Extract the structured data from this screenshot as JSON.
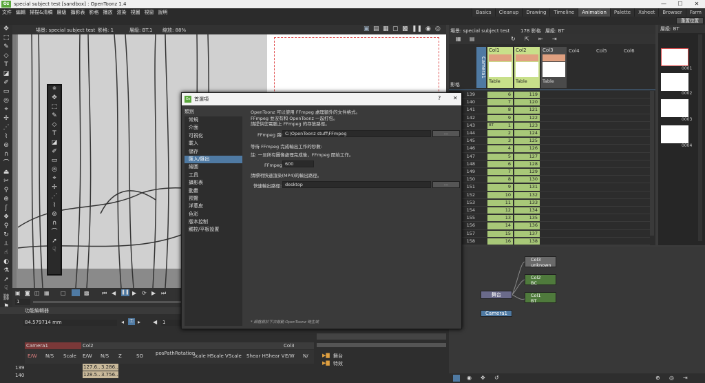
{
  "window": {
    "title": "special subject test [sandbox] : OpenToonz 1.4",
    "logo": "Oz",
    "controls": [
      "—",
      "☐",
      "✕"
    ]
  },
  "menu": [
    "文件",
    "編輯",
    "掃描&清稿",
    "層級",
    "攝影表",
    "影格",
    "播放",
    "渲染",
    "視圖",
    "視窗",
    "說明"
  ],
  "rooms": [
    "Basics",
    "Cleanup",
    "Drawing",
    "Timeline",
    "Animation",
    "Palette",
    "Xsheet",
    "Browser",
    "Farm"
  ],
  "active_room": "Animation",
  "reset_button": "重置位置",
  "viewer": {
    "scene": "場景: special subject test",
    "frame": "影格: 1",
    "level": "層級: BT.1",
    "zoom": "縮放: 88%",
    "frame_field": "1"
  },
  "func_editor": {
    "title": "功能編輯器",
    "value": "84.579714 mm",
    "frame": "1",
    "groups": [
      "Camera1",
      "Col2",
      "Col3"
    ],
    "columns": [
      "E/W",
      "N/S",
      "Scale",
      "E/W",
      "N/S",
      "Z",
      "SO",
      "posPath",
      "Rotation",
      "Scale H",
      "Scale V",
      "Scale",
      "Shear H",
      "Shear V",
      "E/W",
      "N/"
    ],
    "rows": [
      {
        "frame": "139",
        "values": [
          "",
          "",
          "",
          "127.6...",
          "3.286..."
        ]
      },
      {
        "frame": "140",
        "values": [
          "",
          "",
          "",
          "128.5...",
          "3.756..."
        ]
      }
    ]
  },
  "dialog": {
    "title": "首選項",
    "help": "?",
    "category_header": "類別",
    "categories": [
      "常規",
      "介面",
      "可視化",
      "載入",
      "儲存",
      "匯入/匯出",
      "繪圖",
      "工具",
      "攝影表",
      "動畫",
      "預覽",
      "洋蔥皮",
      "色彩",
      "版本控制",
      "觸控/平板設置"
    ],
    "selected_category": "匯入/匯出",
    "intro": [
      "OpenToonz 可以使用 FFmpeg 處理額外的文件格式。",
      "FFmpeg 並沒有和 OpenToonz 一起打包。",
      "請提供您電腦上 FFmpeg 的存放路徑。"
    ],
    "ffmpeg_path_label": "FFmpeg 路徑:",
    "ffmpeg_path_value": "C:\\OpenToonz stuff\\FFmpeg",
    "browse": "...",
    "wait_text": "等待 FFmpeg 完成輸出工作的秒數:",
    "note_text": "註: 一旦所有圖像處理完成後，FFmpeg 開始工作。",
    "timeout_label": "FFmpeg 暫停:",
    "timeout_value": "600",
    "fast_render_text": "請標明快速渲染(MP4)的輸出路徑。",
    "fast_render_label": "快速輸出路徑:",
    "fast_render_value": "desktop",
    "footer": "* 網格將於下次啟動 OpenToonz 時生效"
  },
  "xsheet": {
    "scene": "場景: special subject test",
    "frame": "178 影格",
    "level": "層級: BT",
    "columns": [
      {
        "name": "Col1",
        "label": "Table",
        "color": "#c8e08a"
      },
      {
        "name": "Col2",
        "label": "Table",
        "color": "#c8e08a"
      },
      {
        "name": "Col3",
        "label": "Table",
        "color": "#7a7a7a"
      },
      {
        "name": "Col4",
        "label": "",
        "color": "#7a7a7a"
      },
      {
        "name": "Col5",
        "label": "",
        "color": "#7a7a7a"
      },
      {
        "name": "Col6",
        "label": "",
        "color": "#7a7a7a"
      }
    ],
    "camera_label": "Camera1",
    "row_label": "影格",
    "rows": [
      {
        "f": "139",
        "c1": "6",
        "c2": "119"
      },
      {
        "f": "140",
        "c1": "7",
        "c2": "120"
      },
      {
        "f": "141",
        "c1": "8",
        "c2": "121"
      },
      {
        "f": "142",
        "c1": "9",
        "c2": "122"
      },
      {
        "f": "143",
        "c1": "1",
        "c2": "123",
        "mark": "BT"
      },
      {
        "f": "144",
        "c1": "2",
        "c2": "124"
      },
      {
        "f": "145",
        "c1": "3",
        "c2": "125"
      },
      {
        "f": "146",
        "c1": "4",
        "c2": "126"
      },
      {
        "f": "147",
        "c1": "5",
        "c2": "127"
      },
      {
        "f": "148",
        "c1": "6",
        "c2": "128"
      },
      {
        "f": "149",
        "c1": "7",
        "c2": "129"
      },
      {
        "f": "150",
        "c1": "8",
        "c2": "130"
      },
      {
        "f": "151",
        "c1": "9",
        "c2": "131"
      },
      {
        "f": "152",
        "c1": "10",
        "c2": "132"
      },
      {
        "f": "153",
        "c1": "11",
        "c2": "133"
      },
      {
        "f": "154",
        "c1": "12",
        "c2": "134"
      },
      {
        "f": "155",
        "c1": "13",
        "c2": "135"
      },
      {
        "f": "156",
        "c1": "14",
        "c2": "136"
      },
      {
        "f": "157",
        "c1": "15",
        "c2": "137"
      },
      {
        "f": "158",
        "c1": "16",
        "c2": "138"
      }
    ]
  },
  "level_strip": {
    "header": "層級: BT",
    "frames": [
      "0001",
      "0002",
      "0003",
      "0004"
    ]
  },
  "schematic": {
    "title": "節點",
    "nodes": [
      {
        "name": "Col3",
        "sub": "unknown"
      },
      {
        "name": "Col2",
        "sub": "BC"
      },
      {
        "name": "Col1",
        "sub": "BT"
      }
    ],
    "stage": "舞台",
    "camera": "Camera1"
  },
  "lowmid": {
    "items": [
      "舞台",
      "特效"
    ]
  }
}
